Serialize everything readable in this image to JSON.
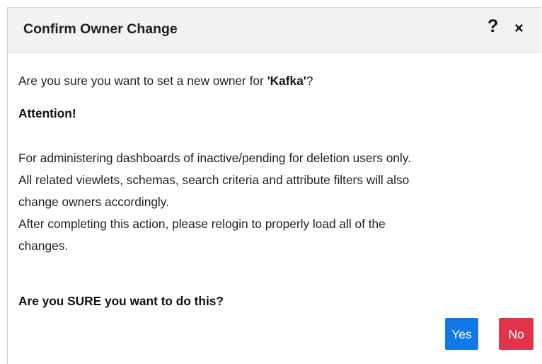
{
  "dialog": {
    "title": "Confirm Owner Change",
    "help_label": "?",
    "close_label": "×"
  },
  "body": {
    "question_prefix": "Are you sure you want to set a new owner for ",
    "question_target": "'Kafka'",
    "question_suffix": "?",
    "attention": "Attention!",
    "lines": [
      "For administering dashboards of inactive/pending for deletion users only.",
      "All related viewlets, schemas, search criteria and attribute filters will also",
      "change owners accordingly.",
      "After completing this action, please relogin to properly load all of the",
      "changes."
    ],
    "final_question": "Are you SURE you want to do this?"
  },
  "buttons": {
    "yes_label": "Yes",
    "no_label": "No"
  },
  "colors": {
    "yes_button": "#1178e8",
    "no_button": "#e0344a",
    "header_background": "#f2f2f2"
  }
}
